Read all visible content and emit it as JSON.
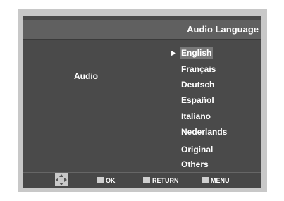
{
  "title": "Audio Language",
  "section_label": "Audio",
  "languages": [
    {
      "label": "English",
      "selected": true
    },
    {
      "label": "Français",
      "selected": false
    },
    {
      "label": "Deutsch",
      "selected": false
    },
    {
      "label": "Español",
      "selected": false
    },
    {
      "label": "Italiano",
      "selected": false
    },
    {
      "label": "Nederlands",
      "selected": false
    },
    {
      "label": "Original",
      "selected": false
    },
    {
      "label": "Others",
      "selected": false
    }
  ],
  "selected_marker": "▶",
  "footer": {
    "ok_label": "OK",
    "return_label": "RETURN",
    "menu_label": "MENU"
  },
  "icons": {
    "dpad": "directional-pad-icon",
    "ok": "enter-icon",
    "return": "return-icon",
    "menu": "menu-icon"
  },
  "colors": {
    "screen_bg": "#4a4a4a",
    "title_bar_bg": "#606060",
    "highlight": "#787878",
    "text": "#ffffff"
  }
}
